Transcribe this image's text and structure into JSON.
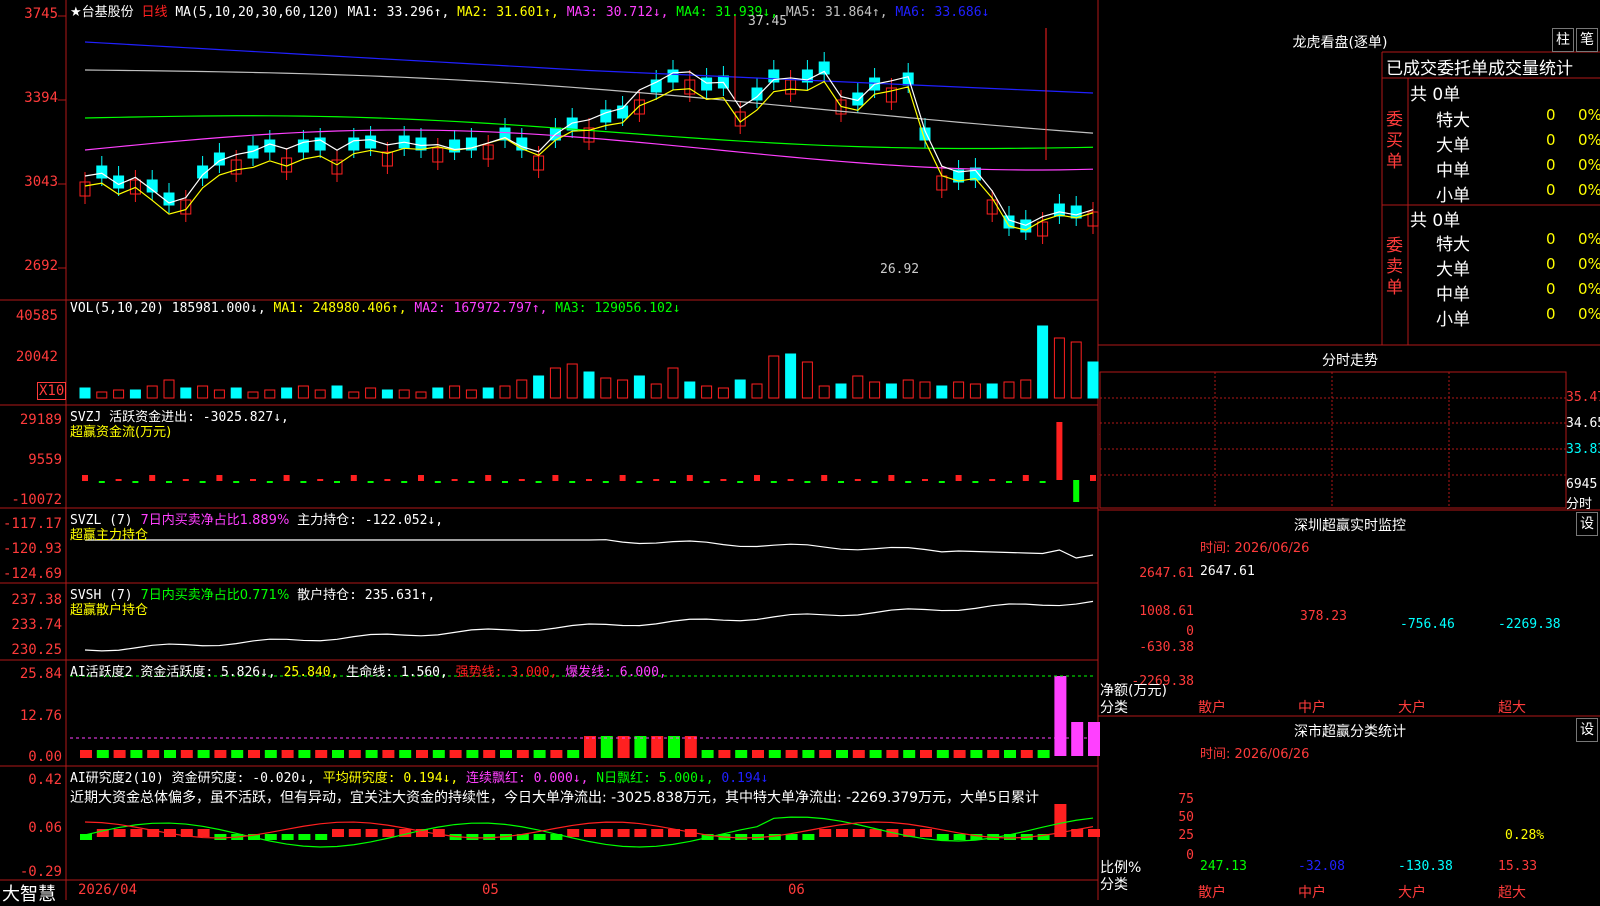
{
  "colors": {
    "up": "#ff2020",
    "down": "#00ffff",
    "frame": "#b01818",
    "ma1": "#ffffff",
    "ma2": "#ffff00",
    "ma3": "#ff40ff",
    "ma4": "#00ff00",
    "ma5": "#c0c0c0",
    "ma6": "#2020ff"
  },
  "main": {
    "stock": "★台基股份",
    "period": "日线",
    "ma_params": "MA(5,10,20,30,60,120)",
    "ma1": "MA1: 33.296↑,",
    "ma2": "MA2: 31.601↑,",
    "ma3": "MA3: 30.712↓,",
    "ma4": "MA4: 31.939↓,",
    "ma5": "MA5: 31.864↑,",
    "ma6": "MA6: 33.686↓",
    "y_labels": [
      "3745",
      "3394",
      "3043",
      "2692"
    ],
    "high_mark": "37.45",
    "low_mark": "26.92"
  },
  "vol": {
    "header": "VOL(5,10,20)",
    "value": "185981.000↓,",
    "ma1": "MA1: 248980.406↑,",
    "ma2": "MA2: 167972.797↑,",
    "ma3": "MA3: 129056.102↓",
    "y_labels": [
      "40585",
      "20042"
    ],
    "unit": "X10"
  },
  "svzj": {
    "header": "SVZJ  活跃资金进出: -3025.827↓,",
    "sub": "超赢资金流(万元)",
    "y_labels": [
      "29189",
      "9559",
      "-10072"
    ]
  },
  "svzl": {
    "header1": "SVZL (7)",
    "header2": "7日内买卖净占比1.889%",
    "header3": "主力持仓: -122.052↓,",
    "sub": "超赢主力持仓",
    "y_labels": [
      "-117.17",
      "-120.93",
      "-124.69"
    ]
  },
  "svsh": {
    "header1": "SVSH (7)",
    "header2": "7日内买卖净占比0.771%",
    "header3": "散户持仓: 235.631↑,",
    "sub": "超赢散户持仓",
    "y_labels": [
      "237.38",
      "233.74",
      "230.25"
    ]
  },
  "ai1": {
    "h1": "AI活跃度2",
    "h2": "资金活跃度: 5.826↓,",
    "h3": "25.840,",
    "h4": "生命线: 1.560,",
    "h5": "强势线: 3.000,",
    "h6": "爆发线: 6.000,",
    "y_labels": [
      "25.84",
      "12.76",
      "0.00"
    ]
  },
  "ai2": {
    "h1": "AI研究度2(10)",
    "h2": "资金研究度: -0.020↓,",
    "h3": "平均研究度: 0.194↓,",
    "h4": "连续飘红: 0.000↓,",
    "h5": "N日飘红: 5.000↓,",
    "h6": "0.194↓",
    "text": "近期大资金总体偏多，虽不活跃，但有异动，宜关注大资金的持续性，今日大单净流出: -3025.838万元，其中特大单净流出: -2269.379万元，大单5日累计",
    "y_labels": [
      "0.42",
      "0.06",
      "-0.29"
    ]
  },
  "footer": {
    "brand": "大智慧",
    "date": "2026/04",
    "month5": "05",
    "month6": "06"
  },
  "right": {
    "dragon_title": "龙虎看盘(逐单)",
    "btn_bar": "柱",
    "btn_pen": "笔",
    "table_title": "已成交委托单成交量统计",
    "buy_total": "共 0单",
    "buy_vert": "委买单",
    "sell_total": "共 0单",
    "sell_vert": "委卖单",
    "buy_rows": [
      [
        "特大",
        "0",
        "0%"
      ],
      [
        "大单",
        "0",
        "0%"
      ],
      [
        "中单",
        "0",
        "0%"
      ],
      [
        "小单",
        "0",
        "0%"
      ]
    ],
    "sell_rows": [
      [
        "特大",
        "0",
        "0%"
      ],
      [
        "大单",
        "0",
        "0%"
      ],
      [
        "中单",
        "0",
        "0%"
      ],
      [
        "小单",
        "0",
        "0%"
      ]
    ],
    "minute_title": "分时走势",
    "minute_y": [
      "35.47",
      "34.65",
      "33.83",
      "6945",
      "分时"
    ],
    "sz_title": "深圳超赢实时监控",
    "set": "设",
    "sz_time": "时间: 2026/06/26",
    "sz_y": [
      "2647.61",
      "1008.61",
      "0",
      "-630.38",
      "-2269.38"
    ],
    "sz_vals": [
      "2647.61",
      "378.23",
      "-756.46",
      "-2269.38"
    ],
    "sz_ylabel1": "净额(万元)",
    "sz_ylabel2": "分类",
    "cats": [
      "散户",
      "中户",
      "大户",
      "超大"
    ],
    "ss_title": "深市超赢分类统计",
    "ss_time": "时间: 2026/06/26",
    "ss_y": [
      "75",
      "50",
      "25",
      "0"
    ],
    "ss_pct": "0.28%",
    "ss_ylabel1": "比例%",
    "ss_ylabel2": "分类",
    "ss_vals": [
      "247.13",
      "-32.08",
      "-130.38",
      "15.33"
    ]
  }
}
